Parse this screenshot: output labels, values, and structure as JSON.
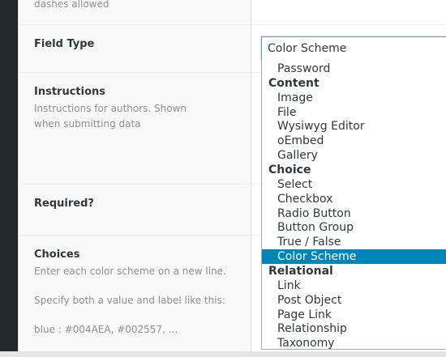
{
  "rows": {
    "name_hint": "dashes allowed",
    "field_type_label": "Field Type",
    "instructions_label": "Instructions",
    "instructions_desc": "Instructions for authors. Shown when submitting data",
    "required_label": "Required?",
    "choices_label": "Choices",
    "choices_desc_1": "Enter each color scheme on a new line.",
    "choices_desc_2": "Specify both a value and label like this:",
    "choices_desc_3": "blue : #004AEA, #002557, ..."
  },
  "field_type_select": {
    "value": "Color Scheme",
    "options": [
      {
        "label": "Password",
        "group": false
      },
      {
        "label": "Content",
        "group": true
      },
      {
        "label": "Image",
        "group": false
      },
      {
        "label": "File",
        "group": false
      },
      {
        "label": "Wysiwyg Editor",
        "group": false
      },
      {
        "label": "oEmbed",
        "group": false
      },
      {
        "label": "Gallery",
        "group": false
      },
      {
        "label": "Choice",
        "group": true
      },
      {
        "label": "Select",
        "group": false
      },
      {
        "label": "Checkbox",
        "group": false
      },
      {
        "label": "Radio Button",
        "group": false
      },
      {
        "label": "Button Group",
        "group": false
      },
      {
        "label": "True / False",
        "group": false
      },
      {
        "label": "Color Scheme",
        "group": false,
        "selected": true
      },
      {
        "label": "Relational",
        "group": true
      },
      {
        "label": "Link",
        "group": false
      },
      {
        "label": "Post Object",
        "group": false
      },
      {
        "label": "Page Link",
        "group": false
      },
      {
        "label": "Relationship",
        "group": false
      },
      {
        "label": "Taxonomy",
        "group": false
      }
    ]
  },
  "colors": {
    "selected_bg": "#0085ba",
    "focus_border": "#5b9dd9",
    "admin_bar": "#23282d"
  }
}
